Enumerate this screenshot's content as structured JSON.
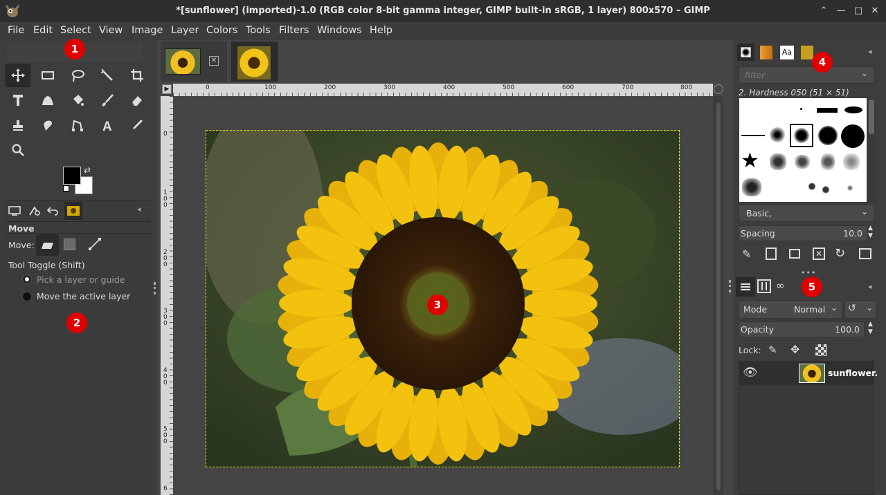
{
  "window": {
    "title": "*[sunflower] (imported)-1.0 (RGB color 8-bit gamma integer, GIMP built-in sRGB, 1 layer) 800x570 – GIMP"
  },
  "menu": [
    "File",
    "Edit",
    "Select",
    "View",
    "Image",
    "Layer",
    "Colors",
    "Tools",
    "Filters",
    "Windows",
    "Help"
  ],
  "tool_options": {
    "title": "Move",
    "move_label": "Move:",
    "toggle_label": "Tool Toggle  (Shift)",
    "option_pick": "Pick a layer or guide",
    "option_move": "Move the active layer"
  },
  "ruler": {
    "top_ticks": [
      "0",
      "100",
      "200",
      "300",
      "400",
      "500",
      "600",
      "700",
      "800"
    ],
    "left_ticks": [
      "0",
      "1\n0\n0",
      "2\n0\n0",
      "3\n0\n0",
      "4\n0\n0",
      "5\n0\n0",
      "6"
    ]
  },
  "brushes": {
    "filter_placeholder": "filter",
    "selected_name": "2. Hardness 050 (51 × 51)",
    "tag_value": "Basic,",
    "spacing_label": "Spacing",
    "spacing_value": "10.0"
  },
  "layers": {
    "mode_label": "Mode",
    "mode_value": "Normal",
    "opacity_label": "Opacity",
    "opacity_value": "100.0",
    "lock_label": "Lock:",
    "layer_name": "sunflower."
  },
  "annotations": [
    "1",
    "2",
    "3",
    "4",
    "5"
  ],
  "colors": {
    "accent_badge": "#e00000",
    "selection_border": "#e8e800",
    "dark_bg": "#3d3d3d"
  }
}
